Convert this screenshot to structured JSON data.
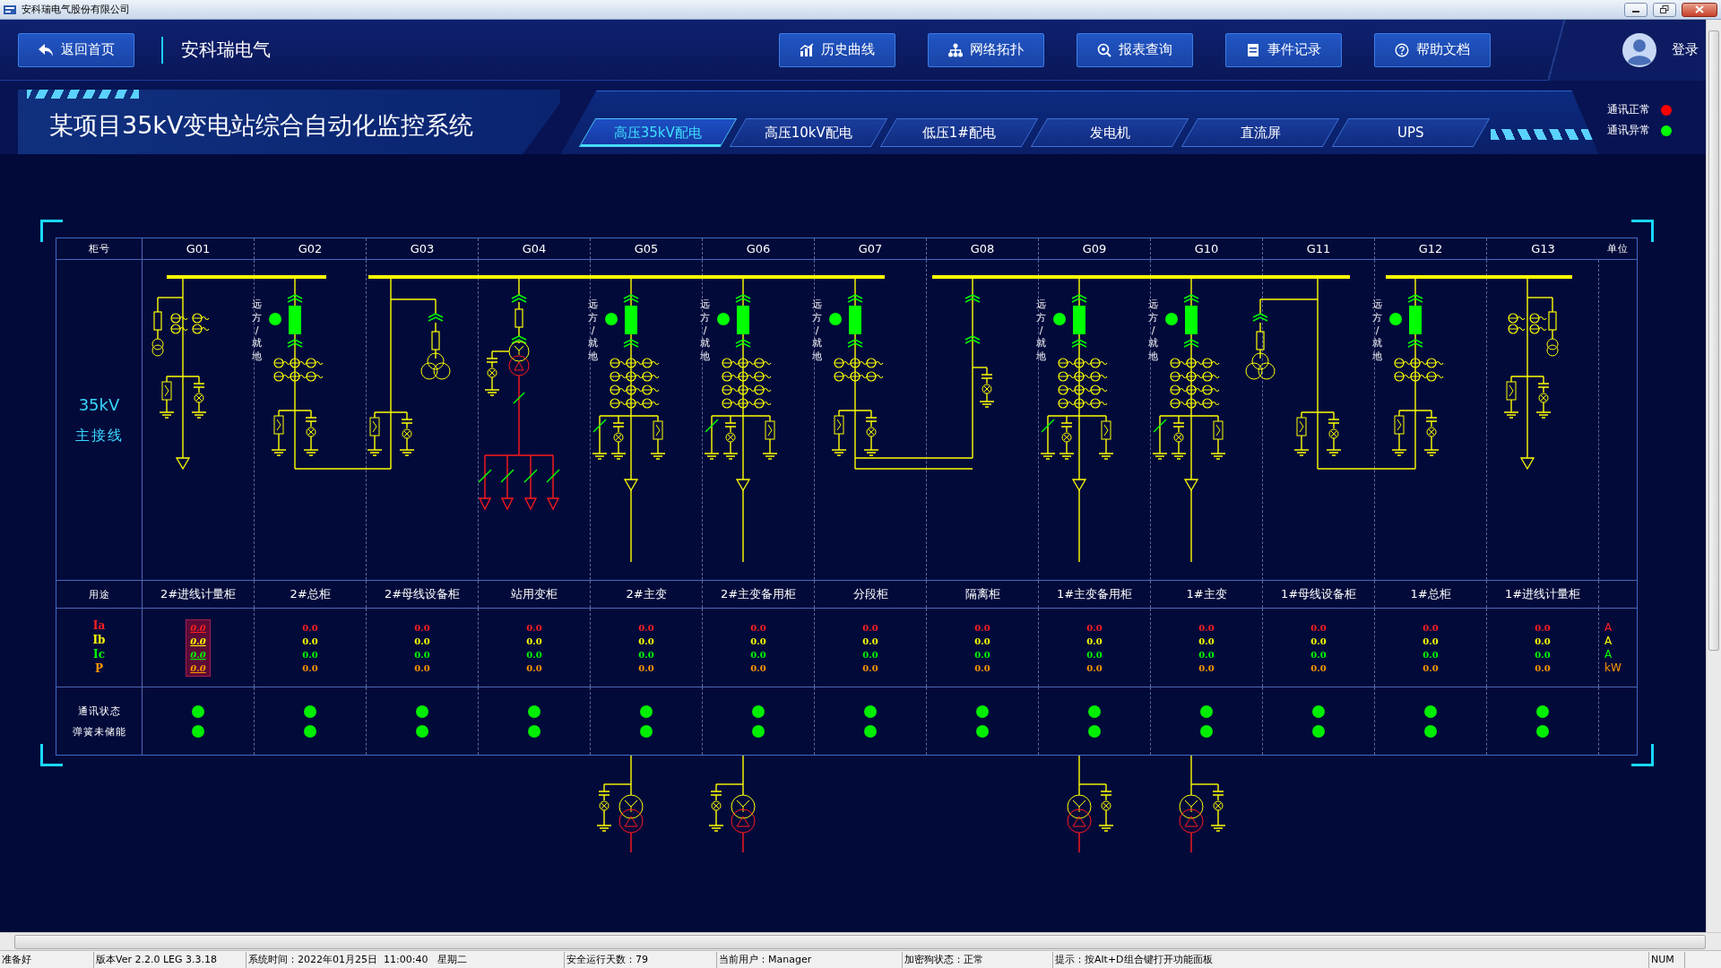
{
  "window": {
    "title": "安科瑞电气股份有限公司"
  },
  "header": {
    "back_button": "返回首页",
    "brand": "安科瑞电气",
    "login": "登录",
    "nav": [
      {
        "label": "历史曲线",
        "kind": "chart"
      },
      {
        "label": "网络拓扑",
        "kind": "network"
      },
      {
        "label": "报表查询",
        "kind": "search"
      },
      {
        "label": "事件记录",
        "kind": "list"
      },
      {
        "label": "帮助文档",
        "kind": "help"
      }
    ]
  },
  "banner": {
    "title": "某项目35kV变电站综合自动化监控系统",
    "tabs": [
      {
        "label": "高压35kV配电",
        "selected": true
      },
      {
        "label": "高压10kV配电",
        "selected": false
      },
      {
        "label": "低压1#配电",
        "selected": false
      },
      {
        "label": "发电机",
        "selected": false
      },
      {
        "label": "直流屏",
        "selected": false
      },
      {
        "label": "UPS",
        "selected": false
      }
    ],
    "legend": [
      {
        "label": "通讯正常",
        "color": "#ff0000"
      },
      {
        "label": "通讯异常",
        "color": "#00ff00"
      }
    ]
  },
  "table": {
    "id_header": "柜号",
    "unit_header": "单位",
    "diagram_label": [
      "35kV",
      "主接线"
    ],
    "purpose_header": "用途",
    "status_labels": [
      "通讯状态",
      "弹簧未储能"
    ],
    "measures": [
      {
        "label": "Ia",
        "unit": "A",
        "color": "#ff2020"
      },
      {
        "label": "Ib",
        "unit": "A",
        "color": "#ffff00"
      },
      {
        "label": "Ic",
        "unit": "A",
        "color": "#00ff00"
      },
      {
        "label": "P",
        "unit": "kW",
        "color": "#ff9900"
      }
    ],
    "cabinets": [
      {
        "id": "G01",
        "kind": "incoming-metering",
        "purpose": "2#进线计量柜",
        "values": [
          "0.0",
          "0.0",
          "0.0",
          "0.0"
        ],
        "highlighted": true,
        "comm_ok": true,
        "spring_ok": true
      },
      {
        "id": "G02",
        "kind": "main",
        "mode_label": "远方/就地",
        "purpose": "2#总柜",
        "values": [
          "0.0",
          "0.0",
          "0.0",
          "0.0"
        ],
        "highlighted": false,
        "comm_ok": true,
        "spring_ok": true
      },
      {
        "id": "G03",
        "kind": "pt",
        "purpose": "2#母线设备柜",
        "values": [
          "0.0",
          "0.0",
          "0.0",
          "0.0"
        ],
        "highlighted": false,
        "comm_ok": true,
        "spring_ok": true
      },
      {
        "id": "G04",
        "kind": "station-transformer",
        "purpose": "站用变柜",
        "values": [
          "0.0",
          "0.0",
          "0.0",
          "0.0"
        ],
        "highlighted": false,
        "comm_ok": true,
        "spring_ok": true
      },
      {
        "id": "G05",
        "kind": "transformer",
        "mode_label": "远方/就地",
        "purpose": "2#主变",
        "values": [
          "0.0",
          "0.0",
          "0.0",
          "0.0"
        ],
        "highlighted": false,
        "comm_ok": true,
        "spring_ok": true
      },
      {
        "id": "G06",
        "kind": "transformer",
        "mode_label": "远方/就地",
        "purpose": "2#主变备用柜",
        "values": [
          "0.0",
          "0.0",
          "0.0",
          "0.0"
        ],
        "highlighted": false,
        "comm_ok": true,
        "spring_ok": true
      },
      {
        "id": "G07",
        "kind": "bus-section",
        "mode_label": "远方/就地",
        "purpose": "分段柜",
        "values": [
          "0.0",
          "0.0",
          "0.0",
          "0.0"
        ],
        "highlighted": false,
        "comm_ok": true,
        "spring_ok": true
      },
      {
        "id": "G08",
        "kind": "isolation",
        "purpose": "隔离柜",
        "values": [
          "0.0",
          "0.0",
          "0.0",
          "0.0"
        ],
        "highlighted": false,
        "comm_ok": true,
        "spring_ok": true
      },
      {
        "id": "G09",
        "kind": "transformer",
        "mode_label": "远方/就地",
        "purpose": "1#主变备用柜",
        "values": [
          "0.0",
          "0.0",
          "0.0",
          "0.0"
        ],
        "highlighted": false,
        "comm_ok": true,
        "spring_ok": true
      },
      {
        "id": "G10",
        "kind": "transformer",
        "mode_label": "远方/就地",
        "purpose": "1#主变",
        "values": [
          "0.0",
          "0.0",
          "0.0",
          "0.0"
        ],
        "highlighted": false,
        "comm_ok": true,
        "spring_ok": true
      },
      {
        "id": "G11",
        "kind": "pt",
        "purpose": "1#母线设备柜",
        "values": [
          "0.0",
          "0.0",
          "0.0",
          "0.0"
        ],
        "highlighted": false,
        "comm_ok": true,
        "spring_ok": true
      },
      {
        "id": "G12",
        "kind": "main",
        "mode_label": "远方/就地",
        "purpose": "1#总柜",
        "values": [
          "0.0",
          "0.0",
          "0.0",
          "0.0"
        ],
        "highlighted": false,
        "comm_ok": true,
        "spring_ok": true
      },
      {
        "id": "G13",
        "kind": "incoming-metering",
        "purpose": "1#进线计量柜",
        "values": [
          "0.0",
          "0.0",
          "0.0",
          "0.0"
        ],
        "highlighted": false,
        "comm_ok": true,
        "spring_ok": true
      }
    ]
  },
  "status_bar": [
    "准备好",
    "版本Ver 2.2.0 LEG 3.3.18",
    "系统时间：2022年01月25日  11:00:40   星期二",
    "安全运行天数：79",
    "当前用户：Manager",
    "加密狗状态：正常",
    "提示：按Alt+D组合键打开功能面板",
    "NUM"
  ]
}
